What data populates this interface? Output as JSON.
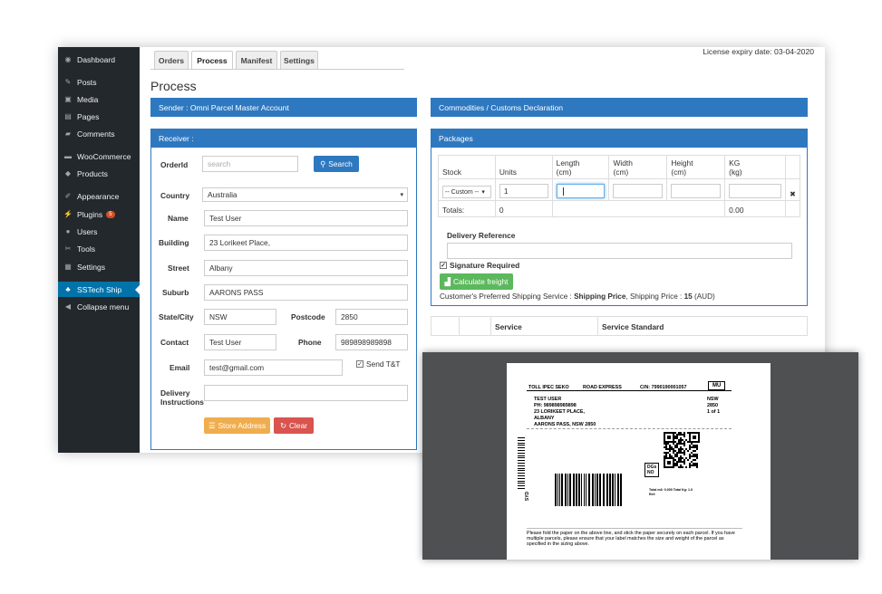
{
  "sidebar": {
    "items": [
      {
        "label": "Dashboard",
        "icon": "dashboard-icon",
        "glyph": "◉"
      },
      {
        "label": "Posts",
        "icon": "pin-icon",
        "glyph": "✎"
      },
      {
        "label": "Media",
        "icon": "media-icon",
        "glyph": "▣"
      },
      {
        "label": "Pages",
        "icon": "pages-icon",
        "glyph": "▤"
      },
      {
        "label": "Comments",
        "icon": "comments-icon",
        "glyph": "▰"
      },
      {
        "label": "WooCommerce",
        "icon": "woocommerce-icon",
        "glyph": "▬"
      },
      {
        "label": "Products",
        "icon": "products-icon",
        "glyph": "◆"
      },
      {
        "label": "Appearance",
        "icon": "appearance-icon",
        "glyph": "✐"
      },
      {
        "label": "Plugins",
        "icon": "plugins-icon",
        "glyph": "⚡",
        "badge": "5"
      },
      {
        "label": "Users",
        "icon": "users-icon",
        "glyph": "●"
      },
      {
        "label": "Tools",
        "icon": "tools-icon",
        "glyph": "✂"
      },
      {
        "label": "Settings",
        "icon": "settings-icon",
        "glyph": "▦"
      },
      {
        "label": "SSTech Ship",
        "icon": "ship-icon",
        "glyph": "♣"
      },
      {
        "label": "Collapse menu",
        "icon": "collapse-icon",
        "glyph": "◀"
      }
    ]
  },
  "tabs": [
    "Orders",
    "Process",
    "Manifest",
    "Settings"
  ],
  "license": "License expiry date: 03-04-2020",
  "page_title": "Process",
  "sender": {
    "heading": "Sender : Omni Parcel Master Account"
  },
  "receiver": {
    "heading": "Receiver :",
    "orderid_label": "OrderId",
    "orderid_placeholder": "search",
    "search_button": "Search",
    "country_label": "Country",
    "country_value": "Australia",
    "name_label": "Name",
    "name_value": "Test User",
    "building_label": "Building",
    "building_value": "23 Lorikeet Place,",
    "street_label": "Street",
    "street_value": "Albany",
    "suburb_label": "Suburb",
    "suburb_value": "AARONS PASS",
    "state_label": "State/City",
    "state_value": "NSW",
    "postcode_label": "Postcode",
    "postcode_value": "2850",
    "contact_label": "Contact",
    "contact_value": "Test User",
    "phone_label": "Phone",
    "phone_value": "989898989898",
    "email_label": "Email",
    "email_value": "test@gmail.com",
    "send_tt_label": "Send T&T",
    "delivery_label_1": "Delivery",
    "delivery_label_2": "Instructions",
    "store_button": "Store Address",
    "clear_button": "Clear"
  },
  "commodities": {
    "heading": "Commodities / Customs Declaration"
  },
  "packages": {
    "heading": "Packages",
    "headers": [
      "Stock",
      "Units",
      "Length\n(cm)",
      "Width\n(cm)",
      "Height\n(cm)",
      "KG\n(kg)"
    ],
    "stock_value": "-- Custom --",
    "units_value": "1",
    "totals_label": "Totals:",
    "totals_units": "0",
    "totals_kg": "0.00",
    "remove_glyph": "✖",
    "delivery_ref_label": "Delivery Reference",
    "signature_label": "Signature Required",
    "calc_button": "Calculate freight",
    "pref_prefix": "Customer's Preferred Shipping Service : ",
    "pref_service": "Shipping Price",
    "pref_price_prefix": ", Shipping Price : ",
    "pref_price": "15",
    "pref_currency": " (AUD)"
  },
  "service_table": {
    "headers": [
      "Service",
      "Service Standard"
    ]
  },
  "label": {
    "carrier": "TOLL IPEC SEKO",
    "service": "ROAD EXPRESS",
    "cn": "C/N: 7990190001057",
    "mu": "MU",
    "recipient_name": "TEST USER",
    "recipient_phone": "PH: 989898989898",
    "recipient_addr1": "23 LORIKEET PLACE,",
    "recipient_addr2": "ALBANY",
    "recipient_addr3": "AARONS PASS, NSW 2850",
    "dest_state": "NSW",
    "dest_postcode": "2850",
    "piece": "1 of 1",
    "dgs": "DGs",
    "dgs_value": "NO",
    "side_code": "SYD",
    "totals": "Total m3: 0.000   Total Kg: 1.0",
    "ref": "Ref:",
    "footer": "Please fold the paper on the above line, and stick the paper securely on each parcel. If you have multiple parcels, please ensure that your label matches the size and weight of the parcel as specified in the sizing above."
  },
  "colors": {
    "primary": "#2e78c0",
    "sidebar": "#23282d",
    "active": "#0073aa",
    "store": "#f0ad4e",
    "clear": "#d9534f",
    "calc": "#5cb85c"
  }
}
